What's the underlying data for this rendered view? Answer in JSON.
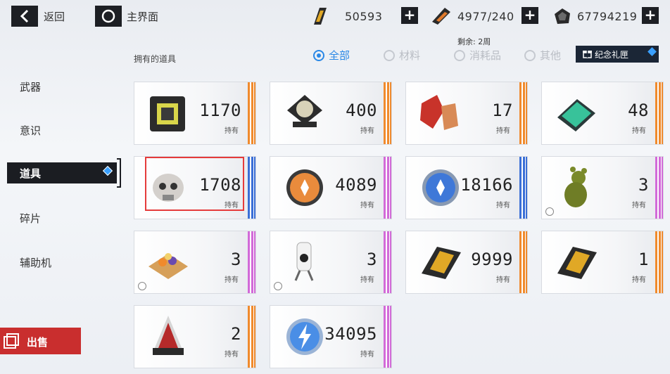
{
  "topbar": {
    "back_label": "返回",
    "home_label": "主界面",
    "resources": [
      {
        "icon": "ticket-icon",
        "value": "50593"
      },
      {
        "icon": "stamina-icon",
        "value": "4977/240"
      },
      {
        "icon": "crystal-icon",
        "value": "67794219"
      }
    ],
    "plus_label": "+"
  },
  "sidebar": {
    "items": [
      "武器",
      "意识",
      "道具",
      "碎片",
      "辅助机"
    ],
    "active_index": 2,
    "sell_label": "出售"
  },
  "filters": {
    "owned_title": "拥有的道具",
    "remaining": "剩余: 2周",
    "tabs": [
      {
        "label": "全部",
        "active": true
      },
      {
        "label": "材料",
        "active": false
      },
      {
        "label": "消耗品",
        "active": false
      },
      {
        "label": "其他",
        "active": false
      }
    ],
    "gift_label": "纪念礼匣"
  },
  "colors": {
    "orange": "#f08a2c",
    "purple": "#d26ad8",
    "blue": "#3b6fd6",
    "accent": "#2a88e6",
    "sell": "#c92e2e"
  },
  "items": [
    {
      "name": "chip-item",
      "count": "1170",
      "own": "持有",
      "rarity": "orange",
      "selectable": false
    },
    {
      "name": "core-item",
      "count": "400",
      "own": "持有",
      "rarity": "orange",
      "selectable": false
    },
    {
      "name": "crystal-shard-item",
      "count": "17",
      "own": "持有",
      "rarity": "orange",
      "selectable": false
    },
    {
      "name": "book-item",
      "count": "48",
      "own": "持有",
      "rarity": "orange",
      "selectable": false
    },
    {
      "name": "skull-item",
      "count": "1708",
      "own": "持有",
      "rarity": "blue",
      "selectable": false
    },
    {
      "name": "orange-coin-item",
      "count": "4089",
      "own": "持有",
      "rarity": "purple",
      "selectable": false
    },
    {
      "name": "blue-coin-item",
      "count": "18166",
      "own": "持有",
      "rarity": "blue",
      "selectable": false
    },
    {
      "name": "teddy-bear-item",
      "count": "3",
      "own": "持有",
      "rarity": "purple",
      "selectable": true
    },
    {
      "name": "waffle-item",
      "count": "3",
      "own": "持有",
      "rarity": "purple",
      "selectable": true
    },
    {
      "name": "robot-item",
      "count": "3",
      "own": "持有",
      "rarity": "purple",
      "selectable": true
    },
    {
      "name": "gold-ticket-item",
      "count": "9999",
      "own": "持有",
      "rarity": "orange",
      "selectable": false
    },
    {
      "name": "gold-ticket-item-2",
      "count": "1",
      "own": "持有",
      "rarity": "orange",
      "selectable": false
    },
    {
      "name": "red-cone-item",
      "count": "2",
      "own": "持有",
      "rarity": "orange",
      "selectable": false
    },
    {
      "name": "lightning-coin-item",
      "count": "34095",
      "own": "持有",
      "rarity": "purple",
      "selectable": false
    }
  ]
}
